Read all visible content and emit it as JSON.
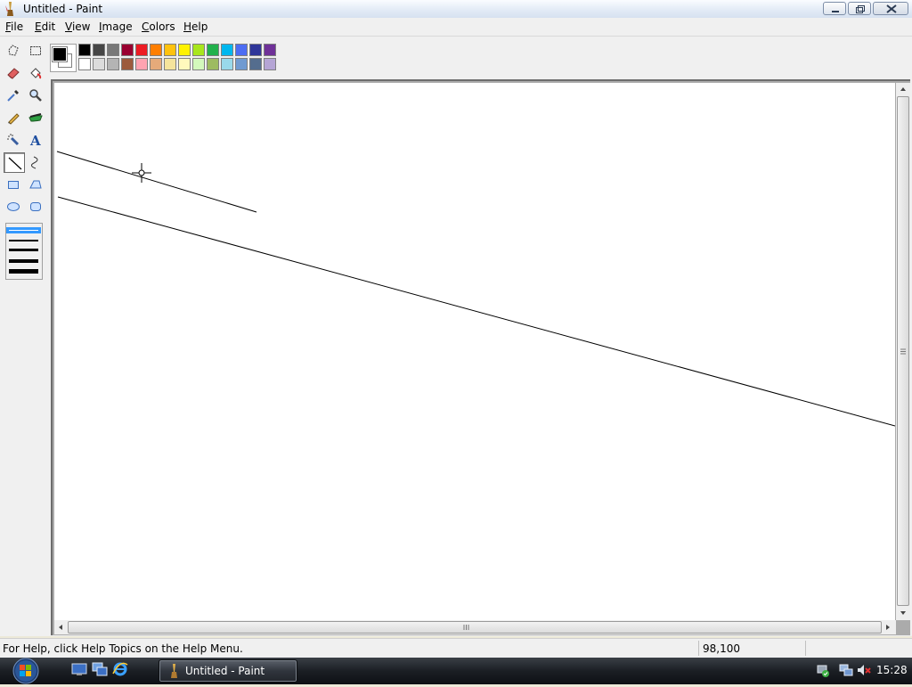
{
  "window": {
    "title": "Untitled - Paint"
  },
  "menu": [
    {
      "label": "File",
      "mnemonic": "F",
      "rest": "ile"
    },
    {
      "label": "Edit",
      "mnemonic": "E",
      "rest": "dit"
    },
    {
      "label": "View",
      "mnemonic": "V",
      "rest": "iew"
    },
    {
      "label": "Image",
      "mnemonic": "I",
      "rest": "mage"
    },
    {
      "label": "Colors",
      "mnemonic": "C",
      "rest": "olors"
    },
    {
      "label": "Help",
      "mnemonic": "H",
      "rest": "elp"
    }
  ],
  "tools": [
    {
      "name": "free-form-select-icon"
    },
    {
      "name": "select-icon"
    },
    {
      "name": "eraser-icon"
    },
    {
      "name": "fill-bucket-icon"
    },
    {
      "name": "color-picker-icon"
    },
    {
      "name": "magnifier-icon"
    },
    {
      "name": "pencil-icon"
    },
    {
      "name": "brush-icon"
    },
    {
      "name": "airbrush-icon"
    },
    {
      "name": "text-icon",
      "glyph": "A"
    },
    {
      "name": "line-icon",
      "selected": true
    },
    {
      "name": "curve-icon"
    },
    {
      "name": "rectangle-icon"
    },
    {
      "name": "polygon-icon"
    },
    {
      "name": "ellipse-icon"
    },
    {
      "name": "rounded-rectangle-icon"
    }
  ],
  "line_widths": {
    "options": 5,
    "selected_index": 0
  },
  "colors": {
    "foreground": "#000000",
    "background": "#ffffff",
    "palette_top": [
      "#000000",
      "#464646",
      "#787878",
      "#990030",
      "#ed1c24",
      "#ff7e00",
      "#ffc20e",
      "#fff200",
      "#a8e61d",
      "#22b14c",
      "#00b7ef",
      "#4d6df3",
      "#2f3699",
      "#6f3198"
    ],
    "palette_bottom": [
      "#ffffff",
      "#dcdcdc",
      "#b4b4b4",
      "#9c5a3c",
      "#ffa3b1",
      "#e5aa7a",
      "#f5e49c",
      "#fff9bd",
      "#d3f9bc",
      "#9dbb61",
      "#99d9ea",
      "#709ad1",
      "#546d8e",
      "#b5a5d5"
    ]
  },
  "status": {
    "help_text": "For Help, click Help Topics on the Help Menu.",
    "coords": "98,100"
  },
  "taskbar": {
    "task_label": "Untitled - Paint",
    "clock": "15:28"
  }
}
